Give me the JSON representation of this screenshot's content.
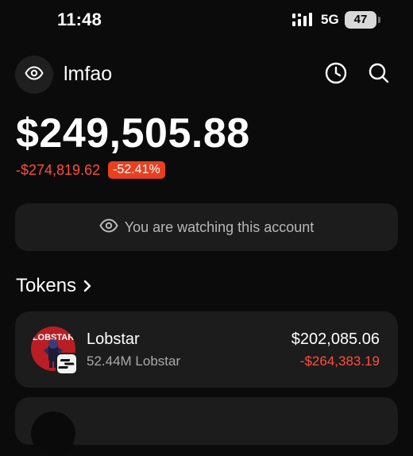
{
  "status_bar": {
    "time": "11:48",
    "network": "5G",
    "battery": "47"
  },
  "header": {
    "account_name": "lmfao",
    "icons": [
      "eye-icon",
      "clock-icon",
      "search-icon"
    ]
  },
  "portfolio": {
    "balance": "$249,505.88",
    "change_amount": "-$274,819.62",
    "change_percent": "-52.41%"
  },
  "watch_banner": {
    "text": "You are watching this account"
  },
  "tokens_section": {
    "title": "Tokens",
    "items": [
      {
        "name": "Lobstar",
        "logo_text": "LOBSTAR",
        "amount": "52.44M Lobstar",
        "value": "$202,085.06",
        "change": "-$264,383.19"
      }
    ]
  },
  "colors": {
    "background": "#0b0b0b",
    "card": "#1c1c1c",
    "negative": "#ff4d3a",
    "negative_badge": "#e8401f",
    "muted_text": "#a9a9a9"
  }
}
